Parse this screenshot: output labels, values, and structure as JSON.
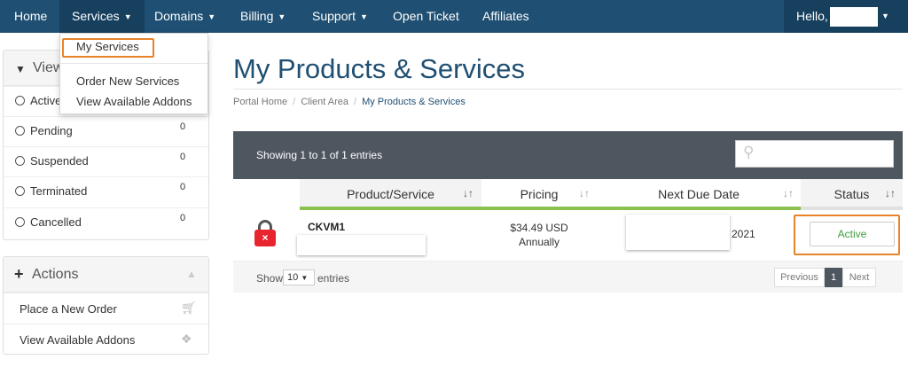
{
  "nav": {
    "items": [
      {
        "label": "Home",
        "caret": false
      },
      {
        "label": "Services",
        "caret": true
      },
      {
        "label": "Domains",
        "caret": true
      },
      {
        "label": "Billing",
        "caret": true
      },
      {
        "label": "Support",
        "caret": true
      },
      {
        "label": "Open Ticket",
        "caret": false
      },
      {
        "label": "Affiliates",
        "caret": false
      }
    ],
    "hello": "Hello,"
  },
  "services_menu": {
    "items": [
      "My Services",
      "Order New Services",
      "View Available Addons"
    ]
  },
  "filter_panel": {
    "title": "View",
    "rows": [
      {
        "label": "Active",
        "count": ""
      },
      {
        "label": "Pending",
        "count": "0"
      },
      {
        "label": "Suspended",
        "count": "0"
      },
      {
        "label": "Terminated",
        "count": "0"
      },
      {
        "label": "Cancelled",
        "count": "0"
      }
    ]
  },
  "actions_panel": {
    "title": "Actions",
    "items": [
      {
        "label": "Place a New Order",
        "icon": "cart-icon"
      },
      {
        "label": "View Available Addons",
        "icon": "cubes-icon"
      }
    ]
  },
  "page": {
    "title": "My Products & Services",
    "breadcrumb": [
      "Portal Home",
      "Client Area",
      "My Products & Services"
    ]
  },
  "table": {
    "showing": "Showing 1 to 1 of 1 entries",
    "columns": [
      "Product/Service",
      "Pricing",
      "Next Due Date",
      "Status"
    ],
    "rows": [
      {
        "product": "CKVM1",
        "price_amount": "$34.49 USD",
        "price_cycle": "Annually",
        "due_visible": "2021",
        "status": "Active"
      }
    ],
    "show_label": "Show",
    "page_length": "10",
    "entries_label": "entries",
    "pagination": {
      "previous": "Previous",
      "current": "1",
      "next": "Next"
    }
  },
  "colors": {
    "navy": "#1f4f72",
    "highlight": "#e8832a",
    "status_green": "#3c9e3c",
    "header_bar": "#4e5660",
    "danger": "#e8242f"
  }
}
